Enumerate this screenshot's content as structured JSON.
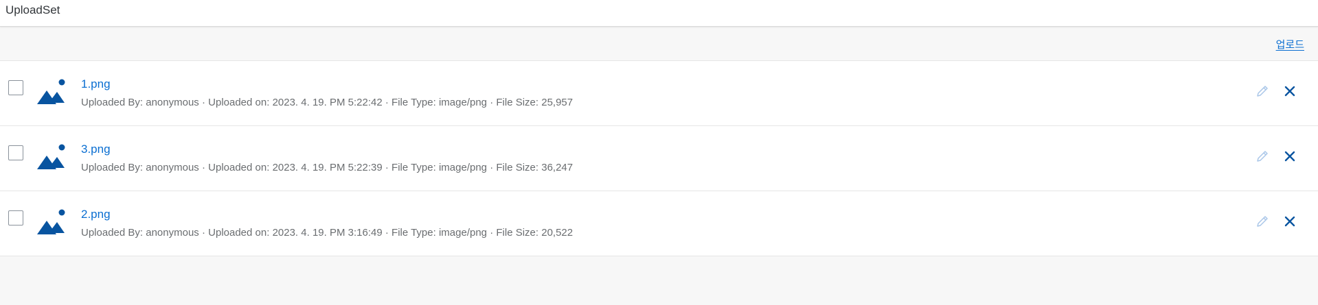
{
  "header": {
    "title": "UploadSet"
  },
  "toolbar": {
    "upload_label": "업로드"
  },
  "items": [
    {
      "file_name": "1.png",
      "uploaded_by_label": "Uploaded By:",
      "uploaded_by": "anonymous",
      "uploaded_on_label": "Uploaded on:",
      "uploaded_on": "2023. 4. 19. PM 5:22:42",
      "file_type_label": "File Type:",
      "file_type": "image/png",
      "file_size_label": "File Size:",
      "file_size": "25,957",
      "icon": "image-icon"
    },
    {
      "file_name": "3.png",
      "uploaded_by_label": "Uploaded By:",
      "uploaded_by": "anonymous",
      "uploaded_on_label": "Uploaded on:",
      "uploaded_on": "2023. 4. 19. PM 5:22:39",
      "file_type_label": "File Type:",
      "file_type": "image/png",
      "file_size_label": "File Size:",
      "file_size": "36,247",
      "icon": "image-icon"
    },
    {
      "file_name": "2.png",
      "uploaded_by_label": "Uploaded By:",
      "uploaded_by": "anonymous",
      "uploaded_on_label": "Uploaded on:",
      "uploaded_on": "2023. 4. 19. PM 3:16:49",
      "file_type_label": "File Type:",
      "file_type": "image/png",
      "file_size_label": "File Size:",
      "file_size": "20,522",
      "icon": "image-icon"
    }
  ],
  "icons": {
    "edit": "pencil-icon",
    "delete": "close-icon"
  },
  "colors": {
    "link": "#0a6ed1",
    "icon": "#0854a0",
    "meta_text": "#6a6d70",
    "background": "#f7f7f7"
  }
}
